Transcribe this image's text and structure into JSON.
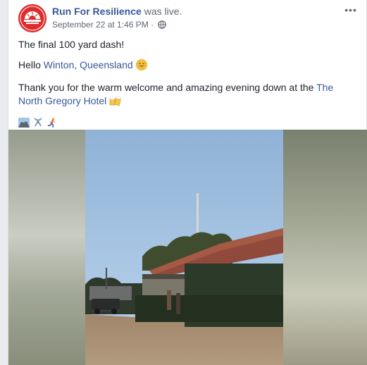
{
  "post": {
    "author": "Run For Resilience",
    "status_text": " was live.",
    "timestamp": "September 22 at 1:46 PM",
    "separator": " · ",
    "privacy_icon": "globe-icon",
    "more_icon": "more-options-icon",
    "more_label": "•••",
    "line1": "The final 100 yard dash!",
    "line2_prefix": "Hello ",
    "line2_link": "Winton, Queensland",
    "line2_emoji": "smiling-face-emoji",
    "line3_prefix": "Thank you for the warm welcome and amazing evening down at the ",
    "line3_link": "The North Gregory Hotel",
    "line3_emoji": "beer-mugs-emoji",
    "line4_emojis": [
      "mountain-emoji",
      "ribbon-emoji",
      "runner-emoji"
    ]
  },
  "colors": {
    "link": "#385898",
    "text": "#1d2129",
    "meta": "#606770",
    "brand": "#e02b2b",
    "background": "#e9ebee"
  }
}
